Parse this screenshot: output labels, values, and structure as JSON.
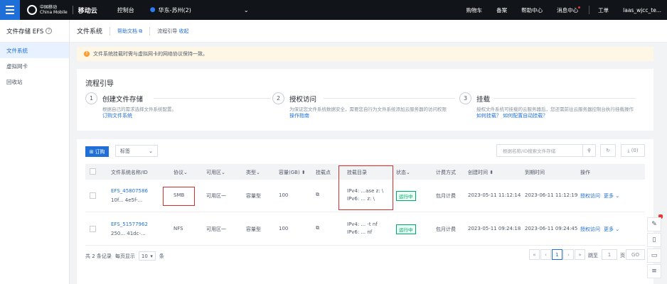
{
  "topbar": {
    "logo_cm": "中国移动\nChina Mobile",
    "logo_text": "移动云",
    "console": "控制台",
    "region": "华东-苏州(2)",
    "cart": "购物车",
    "record": "备案",
    "help": "帮助中心",
    "messages": "消息中心",
    "ticket": "工单",
    "user": "laas_wjcc_te..."
  },
  "sidebar": {
    "title": "文件存储 EFS",
    "items": [
      {
        "label": "文件系统",
        "active": true
      },
      {
        "label": "虚拟网卡",
        "active": false
      },
      {
        "label": "回收站",
        "active": false
      }
    ]
  },
  "header": {
    "title": "文件系统",
    "help_doc": "帮助文档",
    "flow_label": "流程引导",
    "collapse": "收起"
  },
  "notice": "文件系统挂载时需与虚拟网卡的网络协议保持一致。",
  "flow": {
    "title": "流程引导",
    "steps": [
      {
        "num": "1",
        "title": "创建文件存储",
        "desc": "根据自己的需求选择文件系统配置。",
        "link": "订购文件系统"
      },
      {
        "num": "2",
        "title": "授权访问",
        "desc": "为保证您文件系统数据安全，需要您自行为文件系统添加云服务器的访问权限",
        "link": "操作指南"
      },
      {
        "num": "3",
        "title": "挂载",
        "desc": "授权文件系统可挂载的云服务器后，您还需前往云服务器控制台执行挂载操作",
        "link": "如何挂载？ 如何配置自动挂载？"
      }
    ]
  },
  "toolbar": {
    "subscribe": "订购",
    "tag_select": "标签",
    "search_placeholder": "根据名称/ID搜索文件存储",
    "download": "(0)"
  },
  "table": {
    "headers": [
      "文件系统名称/ID",
      "协议",
      "可用区",
      "类型",
      "容量(GB)",
      "挂载点",
      "挂载目录",
      "状态",
      "计费方式",
      "创建时间",
      "到期时间",
      "操作"
    ],
    "rows": [
      {
        "name": "EFS_45807586",
        "id": "10f... 4e5f-...",
        "protocol": "SMB",
        "zone": "可用区一",
        "type": "容量型",
        "capacity": "100",
        "mount_dir_1": "IPv4: ...ase z: \\",
        "mount_dir_2": "IPv6: ... z: \\",
        "status": "运行中",
        "billing": "包月计费",
        "created": "2023-05-11 11:12:14",
        "expires": "2023-06-11 11:12:19",
        "action": "授权访问",
        "more": "更多"
      },
      {
        "name": "EFS_51577962",
        "id": "250... 41dc-...",
        "protocol": "NFS",
        "zone": "可用区一",
        "type": "容量型",
        "capacity": "100",
        "mount_dir_1": "IPv4: ... -t nf",
        "mount_dir_2": "IPv6: ... nf",
        "status": "运行中",
        "billing": "包月计费",
        "created": "2023-05-11 09:24:18",
        "expires": "2023-06-11 09:24:45",
        "action": "授权访问",
        "more": "更多"
      }
    ]
  },
  "pager": {
    "total": "共 2 条记录",
    "per_page_label": "每页显示",
    "per_page": "10",
    "per_page_unit": "条",
    "current": "1",
    "jump_label": "跳至",
    "jump_value": "1",
    "page_unit": "页",
    "go": "GO"
  },
  "colors": {
    "primary": "#1f6fd8",
    "topbar": "#111418",
    "running": "#00a870",
    "highlight": "#d32f2f"
  }
}
